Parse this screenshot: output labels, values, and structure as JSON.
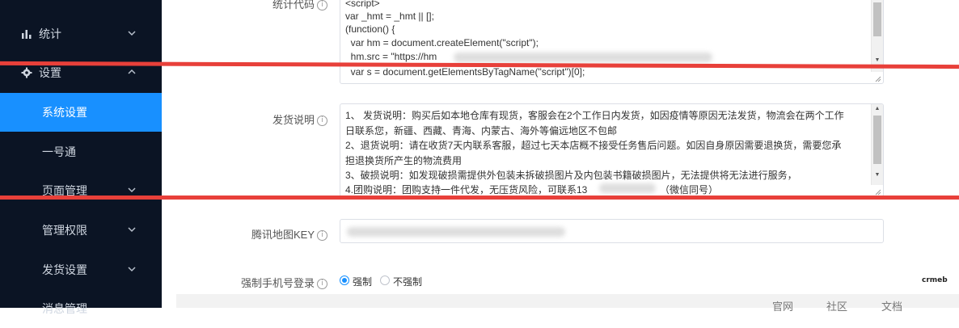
{
  "sidebar": {
    "items": [
      {
        "label": "统计",
        "icon": "bar-chart-icon",
        "chevron": "down"
      },
      {
        "label": "设置",
        "icon": "gear-icon",
        "chevron": "up"
      },
      {
        "label": "系统设置",
        "active": true
      },
      {
        "label": "一号通"
      },
      {
        "label": "页面管理",
        "chevron": "down"
      },
      {
        "label": "管理权限",
        "chevron": "down"
      },
      {
        "label": "发货设置",
        "chevron": "down"
      },
      {
        "label": "消息管理"
      }
    ]
  },
  "form": {
    "stats_code": {
      "label": "统计代码",
      "lines": [
        "<script>",
        "var _hmt = _hmt || [];",
        "(function() {",
        "  var hm = document.createElement(\"script\");",
        "  hm.src = \"https://hm",
        "  var s = document.getElementsByTagName(\"script\")[0];"
      ]
    },
    "shipping": {
      "label": "发货说明",
      "lines": [
        "      1、 发货说明：购买后如本地仓库有现货，客服会在2个工作日内发货，如因疫情等原因无法发货，物流会在两个工作",
        "日联系您，新疆、西藏、青海、内蒙古、海外等偏远地区不包邮",
        "      2、退货说明：请在收货7天内联系客服，超过七天本店概不接受任务售后问题。如因自身原因需要退换货，需要您承",
        "担退换货所产生的物流费用",
        "      3、破损说明：如发现破损需提供外包装未拆破损图片及内包装书籍破损图片，无法提供将无法进行服务，",
        "      4.团购说明：团购支持一件代发，无压货风险，可联系13",
        "（微信同号）"
      ]
    },
    "map_key": {
      "label": "腾讯地图KEY"
    },
    "force_phone": {
      "label": "强制手机号登录",
      "options": [
        "强制",
        "不强制"
      ],
      "selected": "强制"
    }
  },
  "footer": {
    "links": [
      "官网",
      "社区",
      "文档"
    ]
  },
  "watermark": "crmeb",
  "colors": {
    "sidebar_bg": "#0b1424",
    "accent": "#1890ff",
    "annotation_red": "#e8403a"
  }
}
